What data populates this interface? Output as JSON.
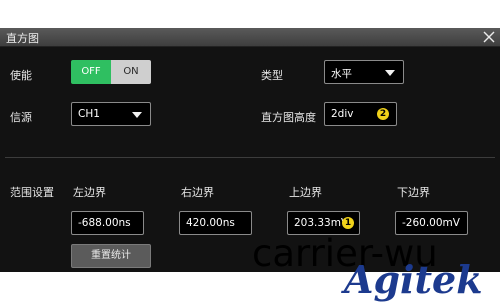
{
  "dialog": {
    "title": "直方图"
  },
  "enable": {
    "label": "使能",
    "off": "OFF",
    "on": "ON",
    "state": "OFF"
  },
  "type": {
    "label": "类型",
    "value": "水平"
  },
  "source": {
    "label": "信源",
    "value": "CH1"
  },
  "height": {
    "label": "直方图高度",
    "value": "2div",
    "badge": "2"
  },
  "range": {
    "label": "范围设置",
    "left": {
      "label": "左边界",
      "value": "-688.00ns"
    },
    "right": {
      "label": "右边界",
      "value": "420.00ns"
    },
    "top": {
      "label": "上边界",
      "value": "203.33mV",
      "badge": "1"
    },
    "bottom": {
      "label": "下边界",
      "value": "-260.00mV"
    }
  },
  "reset_label": "重置统计",
  "watermark": {
    "text": "carrier-wu",
    "logo": "Agitek"
  },
  "colors": {
    "accent_green": "#2fbf61",
    "badge_yellow": "#f0d21a",
    "logo_blue": "#1c3a8e"
  }
}
